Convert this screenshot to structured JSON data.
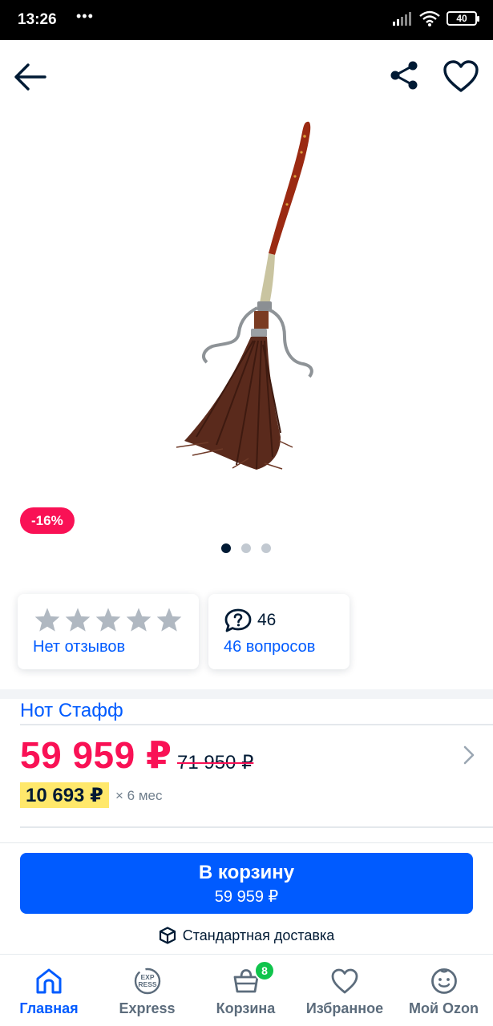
{
  "status_bar": {
    "time": "13:26",
    "dots": "•••",
    "battery": "40"
  },
  "product": {
    "discount": "-16%",
    "image_dots": {
      "count": 3,
      "active": 1
    },
    "brand": "Нот Стафф",
    "price_current": "59 959 ₽",
    "price_old": "71 950 ₽",
    "installment_amount": "10 693 ₽",
    "installment_term": "× 6 мес"
  },
  "reviews": {
    "rating_stars": 0,
    "max_stars": 5,
    "label": "Нет отзывов"
  },
  "questions": {
    "count": "46",
    "label": "46 вопросов"
  },
  "cart_button": {
    "title": "В корзину",
    "price": "59 959 ₽"
  },
  "delivery": {
    "label": "Стандартная доставка"
  },
  "bottom_nav": {
    "items": [
      {
        "label": "Главная",
        "icon": "home-icon",
        "active": true
      },
      {
        "label": "Express",
        "icon": "express-icon"
      },
      {
        "label": "Корзина",
        "icon": "basket-icon",
        "badge": "8"
      },
      {
        "label": "Избранное",
        "icon": "heart-icon"
      },
      {
        "label": "Мой Ozon",
        "icon": "profile-icon"
      }
    ]
  },
  "colors": {
    "accent": "#005bff",
    "price": "#f91155",
    "installment_bg": "#ffe86b",
    "badge_green": "#10c44c"
  }
}
